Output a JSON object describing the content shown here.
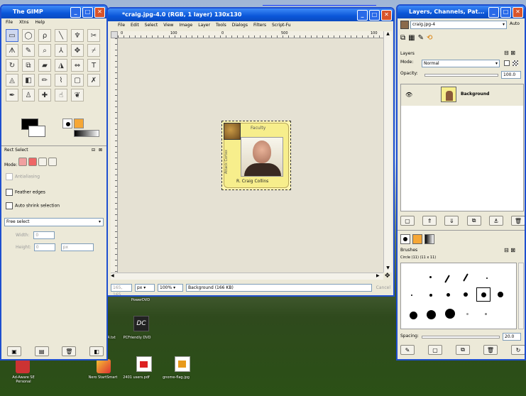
{
  "browser_link": "",
  "toolbox": {
    "title": "The GIMP",
    "menu": [
      "File",
      "Xtns",
      "Help"
    ],
    "tools": [
      "rect-select-icon",
      "ellipse-select-icon",
      "lasso-icon",
      "fuzzy-select-icon",
      "color-select-icon",
      "scissors-icon",
      "paths-icon",
      "pencil-select-icon",
      "zoom-icon",
      "measure-icon",
      "move-icon",
      "crop-icon",
      "rotate-icon",
      "scale-icon",
      "shear-icon",
      "perspective-icon",
      "flip-icon",
      "text-icon",
      "bucket-icon",
      "gradient-icon",
      "pencil-icon",
      "brush-icon",
      "eraser-icon",
      "airbrush-icon",
      "ink-icon",
      "clone-icon",
      "heal-icon",
      "smudge-icon",
      "dodge-icon"
    ],
    "tool_glyphs": [
      "▭",
      "◯",
      "ρ",
      "╲",
      "♆",
      "✂",
      "ᗑ",
      "✎",
      "⌕",
      "⅄",
      "✥",
      "⌿",
      "↻",
      "⧉",
      "▰",
      "◮",
      "⇔",
      "T",
      "◬",
      "◧",
      "✏",
      "⌇",
      "▢",
      "✗",
      "✒",
      "♙",
      "✚",
      "☝",
      "❦"
    ],
    "panel_title": "Rect Select",
    "mode_label": "Mode:",
    "antialiasing": "Antialiasing",
    "feather": "Feather edges",
    "autoshrink": "Auto shrink selection",
    "select_value": "Free select",
    "width_label": "Width:",
    "height_label": "Height:",
    "width_value": "0",
    "height_value": "0",
    "unit": "px"
  },
  "image_window": {
    "title": "*craig.jpg-4.0 (RGB, 1 layer) 130x130",
    "menu": [
      "File",
      "Edit",
      "Select",
      "View",
      "Image",
      "Layer",
      "Tools",
      "Dialogs",
      "Filters",
      "Script-Fu"
    ],
    "ruler_marks": [
      "0",
      "100",
      "0",
      "500",
      "100"
    ],
    "status_unit": "px",
    "zoom": "100%",
    "status_text": "Background (166 KB)",
    "cancel": "Cancel",
    "coords": "165, 165",
    "badge": {
      "label_top": "Faculty",
      "label_side": "Attack Cortex",
      "name": "R. Craig Collins"
    }
  },
  "layers_window": {
    "title": "Layers, Channels, Pat...",
    "image_select": "craig.jpg-4",
    "auto_btn": "Auto",
    "section": "Layers",
    "mode_label": "Mode:",
    "mode_value": "Normal",
    "opacity_label": "Opacity:",
    "opacity_value": "100.0",
    "layer_name": "Background",
    "brushes_label": "Brushes",
    "brush_name": "Circle (11) (11 x 11)",
    "spacing_label": "Spacing:",
    "spacing_value": "20.0"
  },
  "desktop": {
    "icons": [
      {
        "label": "PowerDVD",
        "name": "powerdvd-icon"
      },
      {
        "label": "PCFriendly DVD",
        "name": "pcfriendly-dvd-icon"
      },
      {
        "label": "Ad-Aware SE Personal",
        "name": "adaware-icon"
      },
      {
        "label": "Nero StartSmart",
        "name": "nero-icon"
      },
      {
        "label": "2401 users.pdf",
        "name": "pdf-icon"
      },
      {
        "label": "gnome-flag.jpg",
        "name": "image-file-icon"
      }
    ],
    "partial_label": "4.txt"
  }
}
